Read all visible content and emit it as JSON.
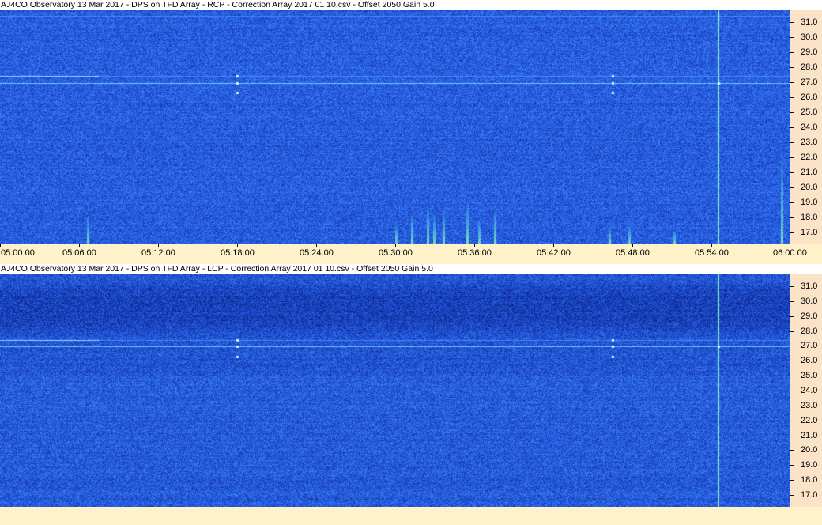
{
  "chart_data": [
    {
      "type": "heatmap",
      "title": "AJ4CO Observatory 13 Mar 2017  -  DPS on TFD Array  -  RCP  -  Correction Array 2017 01 10.csv  -  Offset 2050  Gain 5.0",
      "polarization": "RCP",
      "y_ticks": [
        "31.0",
        "30.0",
        "29.0",
        "28.0",
        "27.0",
        "26.0",
        "25.0",
        "24.0",
        "23.0",
        "22.0",
        "21.0",
        "20.0",
        "19.0",
        "18.0",
        "17.0"
      ],
      "y_range_mhz": [
        16.2,
        31.8
      ],
      "x_ticks": [
        "05:00:00",
        "05:06:00",
        "05:12:00",
        "05:18:00",
        "05:24:00",
        "05:30:00",
        "05:36:00",
        "05:42:00",
        "05:48:00",
        "05:54:00",
        "06:00:00"
      ],
      "x_range": [
        "05:00:00",
        "06:00:00"
      ],
      "colormap": [
        "#0a1f7a",
        "#1f4fd6",
        "#3f86ff",
        "#4ac8ff",
        "#a0f0c0"
      ],
      "interference_lines_mhz": [
        27.4,
        26.95,
        31.45,
        23.3
      ]
    },
    {
      "type": "heatmap",
      "title": "AJ4CO Observatory 13 Mar 2017  -  DPS on TFD Array  -  LCP  -  Correction Array 2017 01 10.csv  -  Offset 2050  Gain 5.0",
      "polarization": "LCP",
      "y_ticks": [
        "31.0",
        "30.0",
        "29.0",
        "28.0",
        "27.0",
        "26.0",
        "25.0",
        "24.0",
        "23.0",
        "22.0",
        "21.0",
        "20.0",
        "19.0",
        "18.0",
        "17.0"
      ],
      "y_range_mhz": [
        16.2,
        31.8
      ],
      "x_range": [
        "05:00:00",
        "06:00:00"
      ],
      "colormap": [
        "#071a6a",
        "#1a46cc",
        "#3a7ef5",
        "#4ac8ff",
        "#a0f0c0"
      ],
      "interference_lines_mhz": [
        27.4,
        26.95
      ]
    }
  ]
}
